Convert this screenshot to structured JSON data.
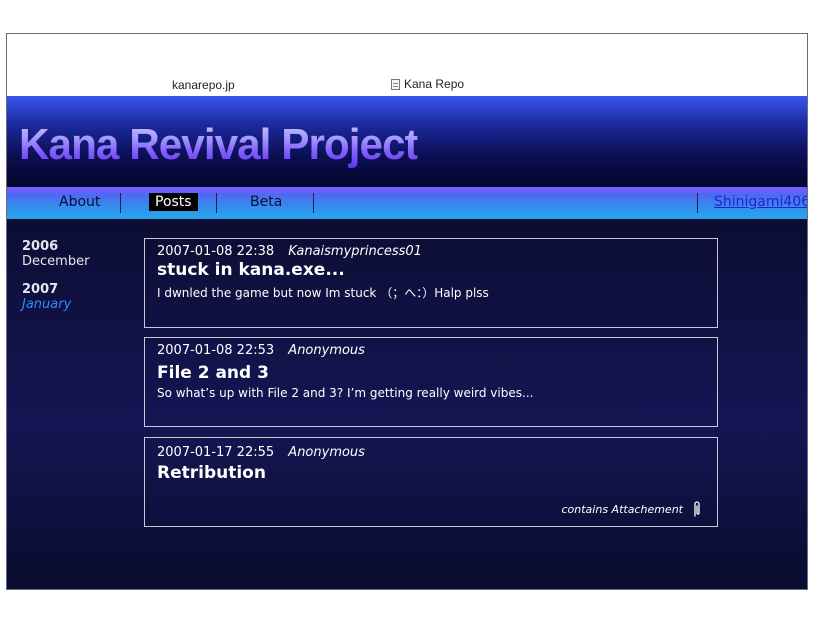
{
  "browser": {
    "url": "kanarepo.jp",
    "tab_title": "Kana Repo"
  },
  "site": {
    "title": "Kana Revival Project"
  },
  "nav": {
    "items": [
      {
        "label": "About"
      },
      {
        "label": "Posts"
      },
      {
        "label": "Beta"
      }
    ],
    "active": "Posts",
    "user": "Shinigami406"
  },
  "archive": {
    "years": [
      {
        "year": "2006",
        "months": [
          "December"
        ]
      },
      {
        "year": "2007",
        "months": [
          "January"
        ]
      }
    ],
    "current_month": "January"
  },
  "posts": [
    {
      "date": "2007-01-08 22:38",
      "author": "Kanaismyprincess01",
      "title": "stuck in kana.exe...",
      "body": "I dwnled the game but now Im stuck  （；へ：）Halp plss"
    },
    {
      "date": "2007-01-08 22:53",
      "author": "Anonymous",
      "title": "File 2 and 3",
      "body": "So what’s up with File 2 and 3? I’m getting really weird vibes..."
    },
    {
      "date": "2007-01-17 22:55",
      "author": "Anonymous",
      "title": "Retribution",
      "body": "",
      "attachment_label": "contains Attachement"
    }
  ],
  "icons": {
    "tab_icon": "document-icon",
    "attachment_icon": "paperclip-icon"
  },
  "colors": {
    "header_blue": "#3a55ee",
    "nav_cyan": "#2aa4ec",
    "background_navy": "#0a0b2b",
    "archive_link": "#2a8cff"
  }
}
